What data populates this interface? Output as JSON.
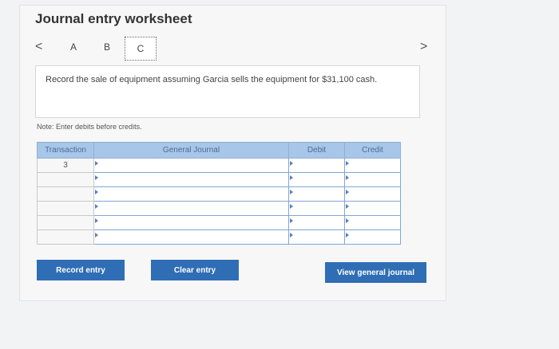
{
  "title": "Journal entry worksheet",
  "nav": {
    "prev": "<",
    "next": ">"
  },
  "tabs": [
    "A",
    "B",
    "C"
  ],
  "question": "Record the sale of equipment assuming Garcia sells the equipment for $31,100 cash.",
  "note": "Note: Enter debits before credits.",
  "table": {
    "headers": [
      "Transaction",
      "General Journal",
      "Debit",
      "Credit"
    ],
    "rows": [
      {
        "transaction": "3"
      },
      {
        "transaction": ""
      },
      {
        "transaction": ""
      },
      {
        "transaction": ""
      },
      {
        "transaction": ""
      },
      {
        "transaction": ""
      }
    ]
  },
  "buttons": {
    "record": "Record entry",
    "clear": "Clear entry",
    "view": "View general journal"
  },
  "colors": {
    "header_bg": "#a8c6e8",
    "button_bg": "#2f6db5"
  }
}
